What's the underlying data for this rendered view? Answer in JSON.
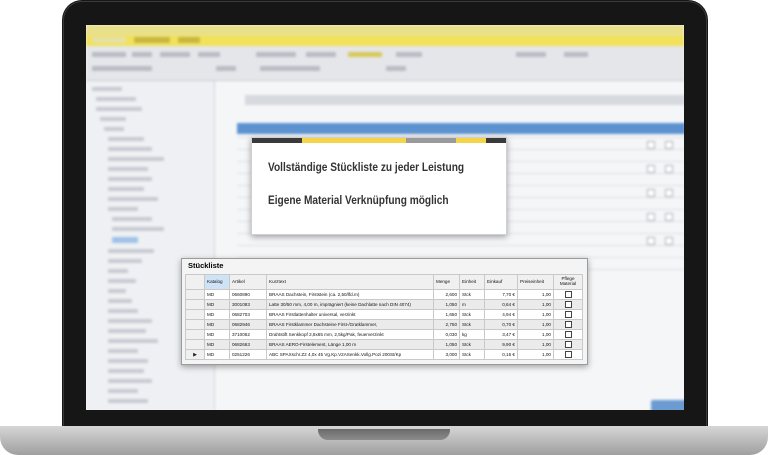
{
  "callout": {
    "line1": "Vollständige Stückliste zu jeder Leistung",
    "line2": "Eigene Material Verknüpfung möglich",
    "stripe_colors": [
      "#3a3a3a",
      "#f3d54b",
      "#f3d54b",
      "#9a9a9a",
      "#f3d54b",
      "#3a3a3a"
    ]
  },
  "stueckliste": {
    "title": "Stückliste",
    "columns": [
      "Katalog",
      "Artikel",
      "Kurztext",
      "Menge",
      "Einheit",
      "Einkauf",
      "Preiseinheit",
      "Pflege Material"
    ],
    "rows": [
      {
        "katalog": "MD",
        "artikel": "0660890",
        "kurztext": "BRAAS Dachstein, Firststein (ca. 2,50/lfd.m)",
        "menge": "2,600",
        "einheit": "Stck",
        "einkauf": "7,70 €",
        "preiseinheit": "1,00",
        "pflege": false
      },
      {
        "katalog": "MD",
        "artikel": "3001083",
        "kurztext": "Latte 30/50 mm, 4,00 m, imprägniert (keine Dachlatte nach DIN 4074)",
        "menge": "1,050",
        "einheit": "m",
        "einkauf": "0,64 €",
        "preiseinheit": "1,00",
        "pflege": false
      },
      {
        "katalog": "MD",
        "artikel": "0682703",
        "kurztext": "BRAAS Firstlattenhalter universal, verzinkt",
        "menge": "1,650",
        "einheit": "Stck",
        "einkauf": "4,94 €",
        "preiseinheit": "1,00",
        "pflege": false
      },
      {
        "katalog": "MD",
        "artikel": "0682946",
        "kurztext": "BRAAS Firstklammer Dachsteine First-/Gratklammer,",
        "menge": "2,750",
        "einheit": "Stck",
        "einkauf": "0,70 €",
        "preiseinheit": "1,00",
        "pflege": false
      },
      {
        "katalog": "MD",
        "artikel": "3710062",
        "kurztext": "Drahtstift Senkkopf 2,8x65 mm, 2,5kg/Pak, feuerverzinkt",
        "menge": "0,030",
        "einheit": "kg",
        "einkauf": "3,47 €",
        "preiseinheit": "1,00",
        "pflege": false
      },
      {
        "katalog": "MD",
        "artikel": "0682663",
        "kurztext": "BRAAS AERO-Firstelement, Länge 1,00 m",
        "menge": "1,050",
        "einheit": "Stck",
        "einkauf": "9,90 €",
        "preiseinheit": "1,00",
        "pflege": false
      },
      {
        "katalog": "MD",
        "artikel": "0251226",
        "kurztext": "ABC SPAXschr.Z2 4,0x 45 Vg.Kp.V2ASenkk.Vollg.Pozi 200St/Kp",
        "menge": "3,000",
        "einheit": "Stck",
        "einkauf": "0,16 €",
        "preiseinheit": "1,00",
        "pflege": false
      }
    ]
  },
  "colors": {
    "ribbon": "#f1e25a",
    "selection": "#5b92cf",
    "header_selected": "#cfe3f6"
  }
}
